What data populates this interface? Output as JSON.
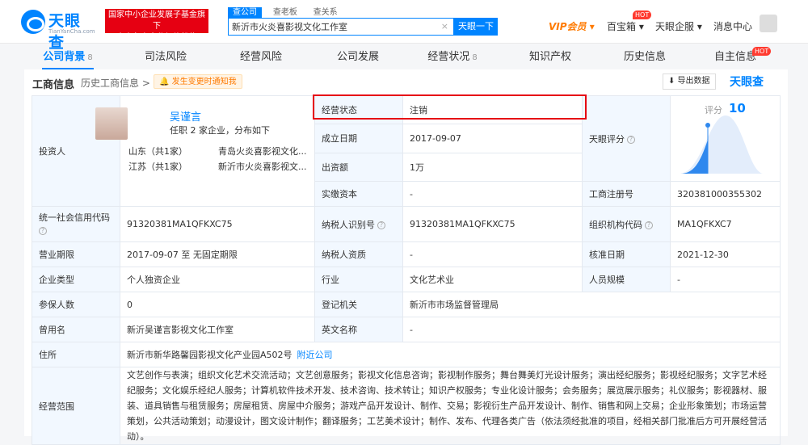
{
  "brand": {
    "name": "天眼查",
    "domain": "TianYanCha.com",
    "gov_line1": "国家中小企业发展子基金旗下",
    "gov_line2": "官方备案企业征信机构"
  },
  "search": {
    "tabs": [
      "查公司",
      "查老板",
      "查关系"
    ],
    "value": "新沂市火炎喜影视文化工作室",
    "clear": "×",
    "button": "天眼一下"
  },
  "nav": {
    "vip": "VIP会员",
    "baibao": "百宝箱",
    "qiye": "天眼企服",
    "msg": "消息中心",
    "hot": "HOT"
  },
  "tabs": [
    {
      "label": "公司背景",
      "count": "8"
    },
    {
      "label": "司法风险",
      "count": ""
    },
    {
      "label": "经营风险",
      "count": ""
    },
    {
      "label": "公司发展",
      "count": ""
    },
    {
      "label": "经营状况",
      "count": "8"
    },
    {
      "label": "知识产权",
      "count": ""
    },
    {
      "label": "历史信息",
      "count": ""
    },
    {
      "label": "自主信息",
      "count": ""
    }
  ],
  "section": {
    "title": "工商信息",
    "history": "历史工商信息 >",
    "notice": "🔔 发生变更时通知我",
    "export": "⬇ 导出数据",
    "brandmark": "天眼查"
  },
  "investor": {
    "label": "投资人",
    "name": "吴谨言",
    "sub": "任职 2 家企业，分布如下",
    "rows": [
      {
        "region": "山东（共1家）",
        "company": "青岛火炎喜影视文化..."
      },
      {
        "region": "江苏（共1家）",
        "company": "新沂市火炎喜影视文..."
      }
    ]
  },
  "status": {
    "label": "经营状态",
    "value": "注销"
  },
  "founded": {
    "label": "成立日期",
    "value": "2017-09-07"
  },
  "capital": {
    "label": "出资额",
    "value": "1万"
  },
  "paid_capital": {
    "label": "实缴资本",
    "value": "-"
  },
  "score": {
    "label": "天眼评分",
    "score_text": "评分",
    "score_value": "10"
  },
  "reg_no": {
    "label": "工商注册号",
    "value": "320381000355302"
  },
  "credit_code": {
    "label": "统一社会信用代码",
    "value": "91320381MA1QFKXC75"
  },
  "tax_id": {
    "label": "纳税人识别号",
    "value": "91320381MA1QFKXC75"
  },
  "org_code": {
    "label": "组织机构代码",
    "value": "MA1QFKXC7"
  },
  "term": {
    "label": "营业期限",
    "value": "2017-09-07  至 无固定期限"
  },
  "tax_quality": {
    "label": "纳税人资质",
    "value": "-"
  },
  "approval_date": {
    "label": "核准日期",
    "value": "2021-12-30"
  },
  "company_type": {
    "label": "企业类型",
    "value": "个人独资企业"
  },
  "industry": {
    "label": "行业",
    "value": "文化艺术业"
  },
  "staff_size": {
    "label": "人员规模",
    "value": "-"
  },
  "insured": {
    "label": "参保人数",
    "value": "0"
  },
  "authority": {
    "label": "登记机关",
    "value": "新沂市市场监督管理局"
  },
  "former_name": {
    "label": "曾用名",
    "value": "新沂吴谨言影视文化工作室"
  },
  "english_name": {
    "label": "英文名称",
    "value": "-"
  },
  "address": {
    "label": "住所",
    "value": "新沂市新华路馨园影视文化产业园A502号",
    "link": "附近公司"
  },
  "scope": {
    "label": "经营范围",
    "value": "文艺创作与表演；组织文化艺术交流活动；文艺创意服务；影视文化信息咨询；影视制作服务；舞台舞美灯光设计服务；演出经纪服务；影视经纪服务；文字艺术经纪服务；文化娱乐经纪人服务；计算机软件技术开发、技术咨询、技术转让；知识产权服务；专业化设计服务；会务服务；展览展示服务；礼仪服务；影视器材、服装、道具销售与租赁服务；房屋租赁、房屋中介服务；游戏产品开发设计、制作、交易；影视衍生产品开发设计、制作、销售和网上交易；企业形象策划；市场运营策划，公共活动策划；动漫设计，图文设计制作；翻译服务；工艺美术设计；制作、发布、代理各类广告（依法须经批准的项目，经相关部门批准后方可开展经营活动）。"
  }
}
